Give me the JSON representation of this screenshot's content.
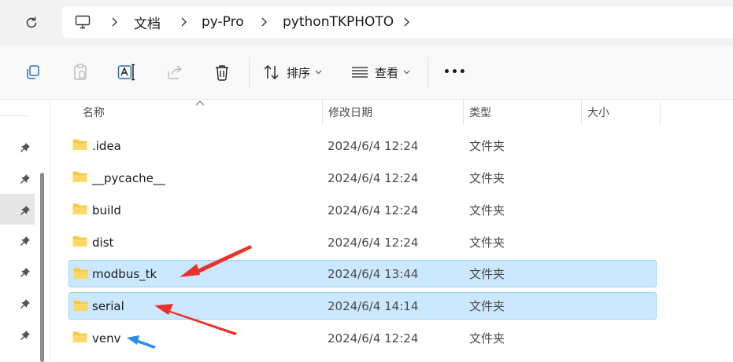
{
  "address": {
    "path": [
      "文档",
      "py-Pro",
      "pythonTKPHOTO"
    ]
  },
  "toolbar": {
    "sort_label": "排序",
    "view_label": "查看",
    "more_label": "•••"
  },
  "columns": {
    "name": "名称",
    "date": "修改日期",
    "type": "类型",
    "size": "大小"
  },
  "files": [
    {
      "name": ".idea",
      "date": "2024/6/4 12:24",
      "type": "文件夹",
      "selected": false
    },
    {
      "name": "__pycache__",
      "date": "2024/6/4 12:24",
      "type": "文件夹",
      "selected": false
    },
    {
      "name": "build",
      "date": "2024/6/4 12:24",
      "type": "文件夹",
      "selected": false
    },
    {
      "name": "dist",
      "date": "2024/6/4 12:24",
      "type": "文件夹",
      "selected": false
    },
    {
      "name": "modbus_tk",
      "date": "2024/6/4 13:44",
      "type": "文件夹",
      "selected": true
    },
    {
      "name": "serial",
      "date": "2024/6/4 14:14",
      "type": "文件夹",
      "selected": true
    },
    {
      "name": "venv",
      "date": "2024/6/4 12:24",
      "type": "文件夹",
      "selected": false
    }
  ],
  "colors": {
    "selection_bg": "#cce8ff",
    "selection_border": "#99d1ff",
    "folder_yellow": "#f8c84a",
    "annotation_red": "#e8322b",
    "annotation_blue": "#2a8cf0"
  }
}
